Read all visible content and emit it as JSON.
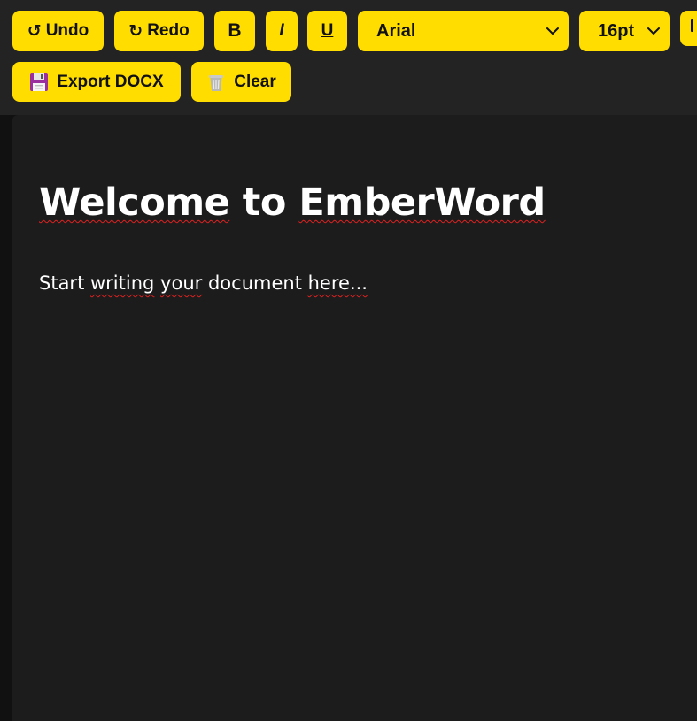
{
  "toolbar": {
    "undo": {
      "label": "Undo",
      "glyph": "↺"
    },
    "redo": {
      "label": "Redo",
      "glyph": "↻"
    },
    "bold": {
      "label": "B"
    },
    "italic": {
      "label": "I"
    },
    "underline": {
      "label": "U"
    },
    "font_family": {
      "value": "Arial"
    },
    "font_size": {
      "value": "16pt"
    },
    "export": {
      "label": "Export DOCX",
      "icon": "floppy-disk-icon"
    },
    "clear": {
      "label": "Clear",
      "icon": "trash-bin-icon"
    }
  },
  "document": {
    "title_words": [
      "Welcome",
      "to",
      "EmberWord"
    ],
    "body_words": [
      "Start",
      "writing",
      "your",
      "document",
      "here..."
    ]
  },
  "colors": {
    "accent": "#ffdd00",
    "toolbar_bg": "#232323",
    "editor_bg": "#1c1c1c",
    "page_bg": "#111111",
    "text": "#ffffff",
    "spellcheck": "#e02020"
  }
}
